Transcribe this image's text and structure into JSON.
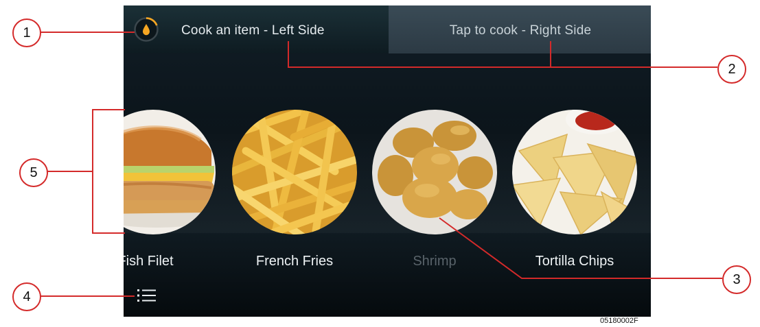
{
  "header": {
    "left_title": "Cook an item - Left Side",
    "right_title": "Tap to cook - Right Side",
    "oil_icon": "oil-drop-icon",
    "accent_color": "#f5a623"
  },
  "menu_items": [
    {
      "label": "Fish Filet",
      "icon": "fish-filet-image",
      "selected": false
    },
    {
      "label": "French Fries",
      "icon": "french-fries-image",
      "selected": false
    },
    {
      "label": "Shrimp",
      "icon": "shrimp-image",
      "selected": false,
      "dimmed": true
    },
    {
      "label": "Tortilla Chips",
      "icon": "tortilla-chips-image",
      "selected": false
    }
  ],
  "footer": {
    "list_icon": "list-icon"
  },
  "callouts": [
    "1",
    "2",
    "3",
    "4",
    "5"
  ],
  "document_code": "05180002F",
  "colors": {
    "callout_line": "#d42a2a",
    "screen_bg": "#0b141a"
  }
}
